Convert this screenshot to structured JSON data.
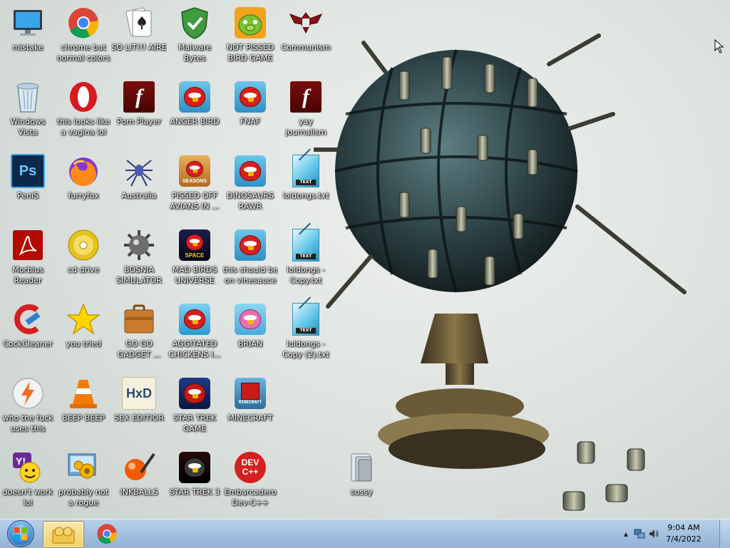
{
  "desktop": {
    "icons": [
      {
        "label": "mistake",
        "icon": "computer-icon"
      },
      {
        "label": "chrome but normal colors",
        "icon": "chrome-icon"
      },
      {
        "label": "SO LIT!!! AIRE",
        "icon": "solitaire-icon"
      },
      {
        "label": "Malware Bytes",
        "icon": "shield-icon"
      },
      {
        "label": "NOT PISSED BIRD GAME",
        "icon": "pig-game-icon"
      },
      {
        "label": "Communism",
        "icon": "eagle-emblem-icon"
      },
      {
        "label": "Windows Vista",
        "icon": "recycle-bin-icon"
      },
      {
        "label": "this looks like a vagina lol",
        "icon": "opera-icon"
      },
      {
        "label": "Porn Player",
        "icon": "flash-icon"
      },
      {
        "label": "ANGER BIRD",
        "icon": "angry-bird-icon"
      },
      {
        "label": "FNAF",
        "icon": "angry-bird-icon"
      },
      {
        "label": "yay journalism",
        "icon": "flash-icon"
      },
      {
        "label": "PeniS",
        "icon": "photoshop-icon"
      },
      {
        "label": "furryfox",
        "icon": "firefox-icon"
      },
      {
        "label": "Australia",
        "icon": "spider-icon"
      },
      {
        "label": "PISSED OFF AVIANS IN ...",
        "icon": "angry-bird-seasons-icon"
      },
      {
        "label": "DINOSAURS RAWR",
        "icon": "angry-bird-icon"
      },
      {
        "label": "loldongs.txt",
        "icon": "text-file-icon"
      },
      {
        "label": "Morbius Reader",
        "icon": "pdf-reader-icon"
      },
      {
        "label": "cd drive",
        "icon": "cd-icon"
      },
      {
        "label": "BOSNIA SIMULATOR",
        "icon": "mine-icon"
      },
      {
        "label": "MAD BIRDS UNIVERSE",
        "icon": "angry-bird-space-icon"
      },
      {
        "label": "this should be on vinesauce",
        "icon": "angry-bird-icon"
      },
      {
        "label": "loldongs - Copy.txt",
        "icon": "text-file-icon"
      },
      {
        "label": "CockCleaner",
        "icon": "ccleaner-icon"
      },
      {
        "label": "you tried",
        "icon": "star-icon"
      },
      {
        "label": "GO GO GADGET ...",
        "icon": "briefcase-icon"
      },
      {
        "label": "AGGITATED CHICKENS I...",
        "icon": "angry-bird-rio-icon"
      },
      {
        "label": "BRIAN",
        "icon": "bird-slingshot-icon"
      },
      {
        "label": "loldongs - Copy (2).txt",
        "icon": "text-file-icon"
      },
      {
        "label": "who the fuck uses this",
        "icon": "winamp-icon"
      },
      {
        "label": "BEEP BEEP",
        "icon": "vlc-icon"
      },
      {
        "label": "SEX EDITIOR",
        "icon": "hxd-icon"
      },
      {
        "label": "STAR TREK GAME",
        "icon": "angry-bird-star-wars-icon"
      },
      {
        "label": "MINECRAFT",
        "icon": "minecraft-bird-icon"
      },
      {
        "label": "doesn't work lol",
        "icon": "yahoo-messenger-icon"
      },
      {
        "label": "probably not a rogue",
        "icon": "control-panel-icon"
      },
      {
        "label": "INKBALLS",
        "icon": "inkball-icon"
      },
      {
        "label": "STAR TREK 3",
        "icon": "angry-bird-star-wars-2-icon"
      },
      {
        "label": "Embarcadero Dev-C++",
        "icon": "devcpp-icon"
      },
      {
        "label": "sussy",
        "icon": "folder-icon"
      }
    ],
    "icon_texts": {
      "photoshop": "Ps",
      "flash": "f",
      "txt_tag": "TEXT",
      "devcpp_top": "DEV",
      "devcpp_bottom": "C++",
      "minecraft": "MINECRAFT",
      "space": "SPACE",
      "seasons": "SEASONS",
      "hxd": "HxD",
      "yahoo": "Y!"
    }
  },
  "taskbar": {
    "start_label": "Start",
    "pinned": [
      {
        "name": "Windows Explorer",
        "icon": "explorer-folders-icon",
        "active": true
      },
      {
        "name": "Google Chrome",
        "icon": "chrome-icon",
        "active": false
      }
    ],
    "tray": {
      "show_hidden_icon": "▲",
      "time": "9:04 AM",
      "date": "7/4/2022"
    }
  },
  "colors": {
    "taskbar": "#a6c2e0",
    "label_text": "#ffffff",
    "bird_red": "#d81e1e"
  }
}
